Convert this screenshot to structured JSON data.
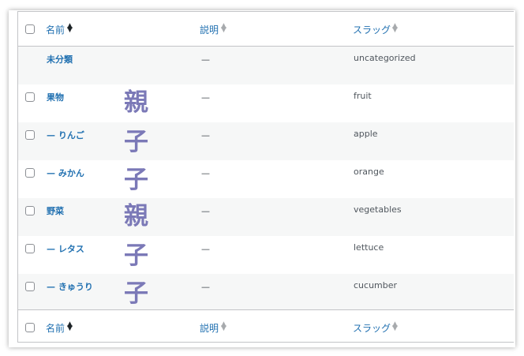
{
  "header": {
    "name_label": "名前",
    "desc_label": "説明",
    "slug_label": "スラッグ"
  },
  "footer": {
    "name_label": "名前",
    "desc_label": "説明",
    "slug_label": "スラッグ"
  },
  "rows": [
    {
      "name": "未分類",
      "desc": "—",
      "slug": "uncategorized",
      "badge": ""
    },
    {
      "name": "果物",
      "desc": "—",
      "slug": "fruit",
      "badge": "親"
    },
    {
      "name": "— りんご",
      "desc": "—",
      "slug": "apple",
      "badge": "子"
    },
    {
      "name": "— みかん",
      "desc": "—",
      "slug": "orange",
      "badge": "子"
    },
    {
      "name": "野菜",
      "desc": "—",
      "slug": "vegetables",
      "badge": "親"
    },
    {
      "name": "— レタス",
      "desc": "—",
      "slug": "lettuce",
      "badge": "子"
    },
    {
      "name": "— きゅうり",
      "desc": "—",
      "slug": "cucumber",
      "badge": "子"
    }
  ],
  "colors": {
    "link": "#2271b1",
    "badge": "#7b79b7",
    "alt_row": "#f6f7f7",
    "border": "#c3c4c7"
  }
}
